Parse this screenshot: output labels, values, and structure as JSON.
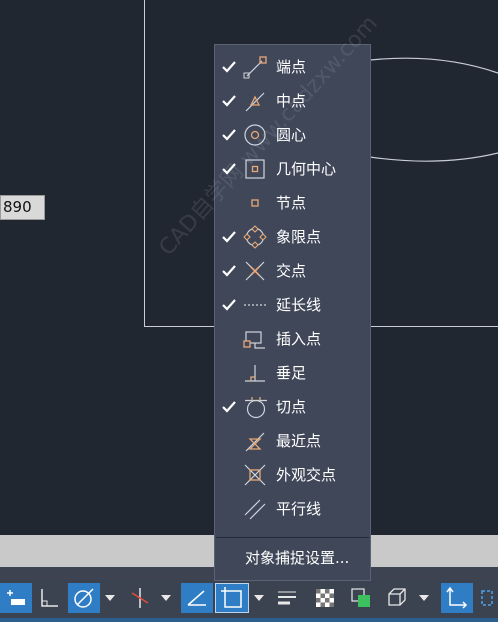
{
  "coordinate_readout": "890",
  "watermark": "CAD自学网 www.cadzxw.com",
  "osnap_menu": {
    "items": [
      {
        "label": "端点",
        "checked": true,
        "icon": "endpoint-icon"
      },
      {
        "label": "中点",
        "checked": true,
        "icon": "midpoint-icon"
      },
      {
        "label": "圆心",
        "checked": true,
        "icon": "center-icon"
      },
      {
        "label": "几何中心",
        "checked": true,
        "icon": "geometric-center-icon"
      },
      {
        "label": "节点",
        "checked": false,
        "icon": "node-icon"
      },
      {
        "label": "象限点",
        "checked": true,
        "icon": "quadrant-icon"
      },
      {
        "label": "交点",
        "checked": true,
        "icon": "intersection-icon"
      },
      {
        "label": "延长线",
        "checked": true,
        "icon": "extension-icon"
      },
      {
        "label": "插入点",
        "checked": false,
        "icon": "insertion-icon"
      },
      {
        "label": "垂足",
        "checked": false,
        "icon": "perpendicular-icon"
      },
      {
        "label": "切点",
        "checked": true,
        "icon": "tangent-icon"
      },
      {
        "label": "最近点",
        "checked": false,
        "icon": "nearest-icon"
      },
      {
        "label": "外观交点",
        "checked": false,
        "icon": "apparent-intersection-icon"
      },
      {
        "label": "平行线",
        "checked": false,
        "icon": "parallel-icon"
      }
    ],
    "settings_label": "对象捕捉设置..."
  },
  "status_bar": {
    "buttons": [
      {
        "name": "dynamic-input-button",
        "active": true
      },
      {
        "name": "ortho-button",
        "active": false
      },
      {
        "name": "polar-tracking-button",
        "active": true
      },
      {
        "name": "isodraft-button",
        "active": false
      },
      {
        "name": "object-snap-tracking-button",
        "active": true
      },
      {
        "name": "object-snap-button",
        "active": true
      },
      {
        "name": "lineweight-button",
        "active": false
      },
      {
        "name": "transparency-button",
        "active": false
      },
      {
        "name": "selection-cycling-button",
        "active": false
      },
      {
        "name": "3d-osnap-button",
        "active": false
      },
      {
        "name": "dynamic-ucs-button",
        "active": true
      }
    ]
  },
  "colors": {
    "canvas": "#212731",
    "menu_bg": "#3f4759",
    "active_button": "#2f7dc4",
    "snap_marker": "#e8a878"
  }
}
